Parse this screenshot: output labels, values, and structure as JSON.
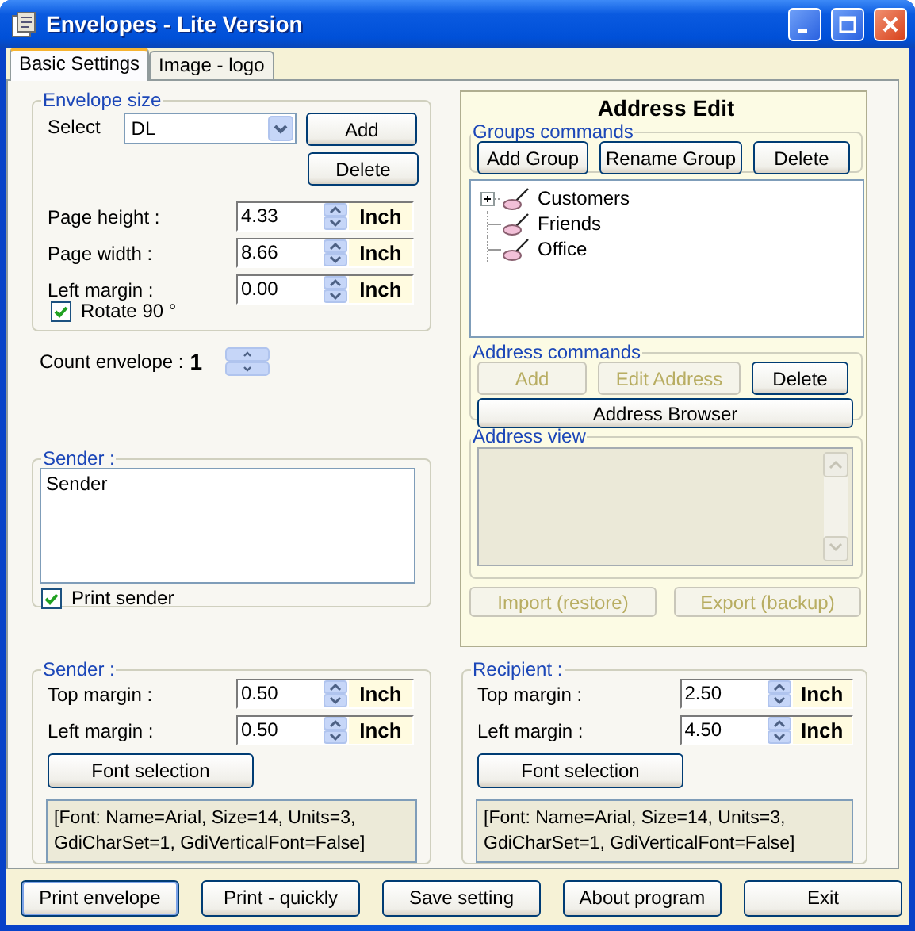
{
  "window": {
    "title": "Envelopes - Lite Version"
  },
  "tabs": [
    {
      "label": "Basic Settings",
      "selected": true
    },
    {
      "label": "Image - logo",
      "selected": false
    }
  ],
  "envelope_size": {
    "legend": "Envelope size",
    "select_label": "Select",
    "select_value": "DL",
    "buttons": [
      {
        "label": "Add",
        "disabled": false
      },
      {
        "label": "Delete",
        "disabled": false
      }
    ],
    "fields": [
      {
        "label": "Page height :",
        "value": "4.33",
        "unit": "Inch"
      },
      {
        "label": "Page width :",
        "value": "8.66",
        "unit": "Inch"
      },
      {
        "label": "Left margin  :",
        "value": "0.00",
        "unit": "Inch"
      }
    ],
    "rotate": {
      "label": "Rotate 90 °",
      "checked": true
    }
  },
  "count": {
    "label": "Count envelope :",
    "value": "1"
  },
  "sender": {
    "legend": "Sender :",
    "text": "Sender",
    "print": {
      "label": "Print sender",
      "checked": true
    }
  },
  "positions": [
    {
      "legend": "Sender :",
      "fields": [
        {
          "label": "Top margin  :",
          "value": "0.50",
          "unit": "Inch"
        },
        {
          "label": "Left margin :",
          "value": "0.50",
          "unit": "Inch"
        }
      ],
      "font_button": "Font selection",
      "font_info": "[Font: Name=Arial, Size=14, Units=3, GdiCharSet=1, GdiVerticalFont=False]"
    },
    {
      "legend": "Recipient :",
      "fields": [
        {
          "label": "Top margin  :",
          "value": "2.50",
          "unit": "Inch"
        },
        {
          "label": "Left margin  :",
          "value": "4.50",
          "unit": "Inch"
        }
      ],
      "font_button": "Font selection",
      "font_info": "[Font: Name=Arial, Size=14, Units=3, GdiCharSet=1, GdiVerticalFont=False]"
    }
  ],
  "address_edit": {
    "title": "Address Edit",
    "groups_commands": {
      "legend": "Groups commands",
      "buttons": [
        {
          "label": "Add Group",
          "disabled": false
        },
        {
          "label": "Rename Group",
          "disabled": false
        },
        {
          "label": "Delete",
          "disabled": false
        }
      ]
    },
    "groups": [
      {
        "label": "Customers",
        "kind": "collapsed"
      },
      {
        "label": "Friends",
        "kind": "leaf"
      },
      {
        "label": "Office",
        "kind": "leaf"
      }
    ],
    "address_commands": {
      "legend": "Address commands",
      "buttons": [
        {
          "label": "Add",
          "disabled": true
        },
        {
          "label": "Edit Address",
          "disabled": true
        },
        {
          "label": "Delete",
          "disabled": false
        },
        {
          "label": "Address Browser",
          "disabled": false
        }
      ]
    },
    "address_view": {
      "legend": "Address view",
      "disabled": true
    },
    "buttons": [
      {
        "label": "Import (restore)",
        "disabled": true
      },
      {
        "label": "Export (backup)",
        "disabled": true
      }
    ]
  },
  "buttons": [
    {
      "label": "Print envelope",
      "default": true
    },
    {
      "label": "Print - quickly",
      "default": false
    },
    {
      "label": "Save setting",
      "default": false
    },
    {
      "label": "About program",
      "default": false
    },
    {
      "label": "Exit",
      "default": false
    }
  ]
}
